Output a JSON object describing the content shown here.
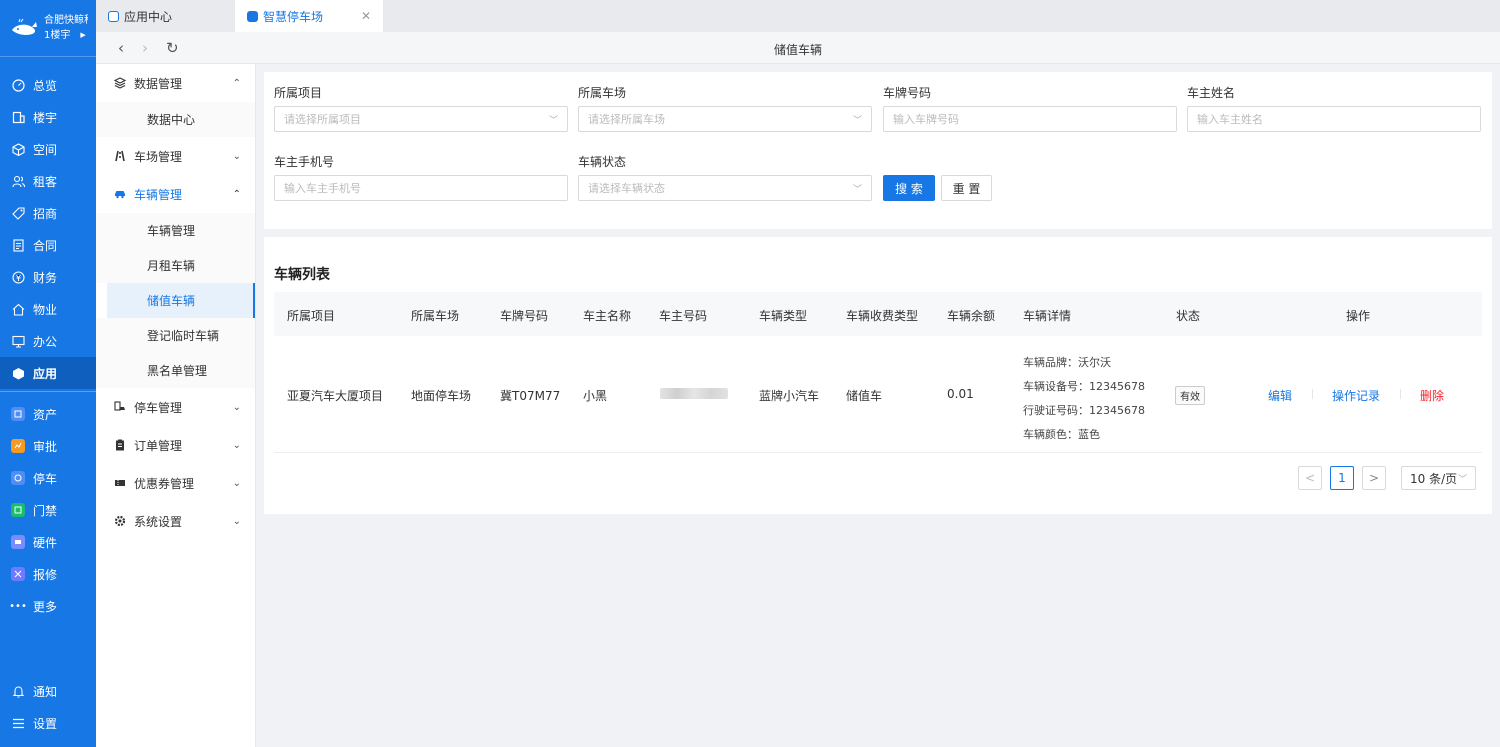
{
  "org": {
    "name": "合肥快鲸科技",
    "building": "1楼宇"
  },
  "leftnav": {
    "items": [
      {
        "label": "总览",
        "icon": "dashboard-icon"
      },
      {
        "label": "楼宇",
        "icon": "building-icon"
      },
      {
        "label": "空间",
        "icon": "cube-icon"
      },
      {
        "label": "租客",
        "icon": "user-group-icon"
      },
      {
        "label": "招商",
        "icon": "tag-icon"
      },
      {
        "label": "合同",
        "icon": "document-icon"
      },
      {
        "label": "财务",
        "icon": "money-icon"
      },
      {
        "label": "物业",
        "icon": "home-icon"
      },
      {
        "label": "办公",
        "icon": "monitor-icon"
      },
      {
        "label": "应用",
        "icon": "app-cube-icon"
      }
    ],
    "apps": [
      {
        "label": "资产",
        "color": "#4f8ef7"
      },
      {
        "label": "审批",
        "color": "#f59a23"
      },
      {
        "label": "停车",
        "color": "#4f8ef7"
      },
      {
        "label": "门禁",
        "color": "#19be6b"
      },
      {
        "label": "硬件",
        "color": "#7b8cff"
      },
      {
        "label": "报修",
        "color": "#6f7bff"
      }
    ],
    "more": "更多",
    "notify": "通知",
    "settings": "设置"
  },
  "tabs": [
    {
      "label": "应用中心"
    },
    {
      "label": "智慧停车场"
    }
  ],
  "page_title": "储值车辆",
  "subnav": {
    "groups": [
      {
        "label": "数据管理",
        "children": [
          "数据中心"
        ]
      },
      {
        "label": "车场管理"
      },
      {
        "label": "车辆管理",
        "children": [
          "车辆管理",
          "月租车辆",
          "储值车辆",
          "登记临时车辆",
          "黑名单管理"
        ]
      },
      {
        "label": "停车管理"
      },
      {
        "label": "订单管理"
      },
      {
        "label": "优惠券管理"
      },
      {
        "label": "系统设置"
      }
    ]
  },
  "filters": {
    "project": {
      "label": "所属项目",
      "placeholder": "请选择所属项目"
    },
    "lot": {
      "label": "所属车场",
      "placeholder": "请选择所属车场"
    },
    "plate": {
      "label": "车牌号码",
      "placeholder": "输入车牌号码"
    },
    "owner": {
      "label": "车主姓名",
      "placeholder": "输入车主姓名"
    },
    "phone": {
      "label": "车主手机号",
      "placeholder": "输入车主手机号"
    },
    "status": {
      "label": "车辆状态",
      "placeholder": "请选择车辆状态"
    },
    "search_btn": "搜 索",
    "reset_btn": "重 置"
  },
  "list": {
    "title": "车辆列表",
    "columns": [
      "所属项目",
      "所属车场",
      "车牌号码",
      "车主名称",
      "车主号码",
      "车辆类型",
      "车辆收费类型",
      "车辆余额",
      "车辆详情",
      "状态",
      "操作"
    ],
    "rows": [
      {
        "project": "亚夏汽车大厦项目",
        "lot": "地面停车场",
        "plate": "冀T07M77",
        "owner": "小黑",
        "vehicle_type": "蓝牌小汽车",
        "charge_type": "储值车",
        "balance": "0.01",
        "details": [
          "车辆品牌：沃尔沃",
          "车辆设备号：12345678",
          "行驶证号码：12345678",
          "车辆颜色：蓝色"
        ],
        "status": "有效",
        "actions": [
          "编辑",
          "操作记录",
          "删除"
        ]
      }
    ]
  },
  "pagination": {
    "prev": "<",
    "page": "1",
    "next": ">",
    "page_size": "10 条/页"
  },
  "colors": {
    "primary": "#1677e5",
    "danger": "#f5222d"
  }
}
